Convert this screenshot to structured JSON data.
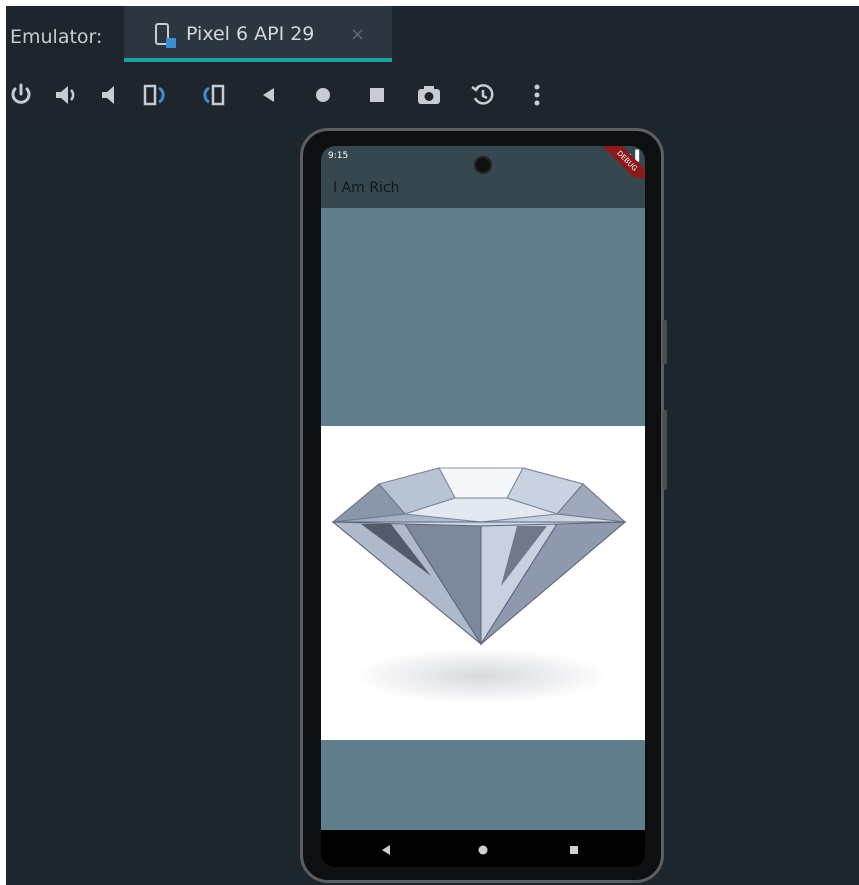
{
  "window": {
    "emulator_label": "Emulator:",
    "tab": {
      "title": "Pixel 6 API 29",
      "close_symbol": "×",
      "icon": "phone-device-icon"
    }
  },
  "toolbar": {
    "buttons": [
      {
        "name": "power-button",
        "icon": "power-icon"
      },
      {
        "name": "volume-up-button",
        "icon": "volume-up-icon"
      },
      {
        "name": "volume-down-button",
        "icon": "volume-down-icon"
      },
      {
        "name": "rotate-left-button",
        "icon": "rotate-left-icon"
      },
      {
        "name": "rotate-right-button",
        "icon": "rotate-right-icon"
      },
      {
        "name": "back-button",
        "icon": "back-triangle-icon"
      },
      {
        "name": "home-button",
        "icon": "home-circle-icon"
      },
      {
        "name": "overview-button",
        "icon": "overview-square-icon"
      },
      {
        "name": "screenshot-button",
        "icon": "camera-icon"
      },
      {
        "name": "snapshot-button",
        "icon": "snapshot-icon"
      },
      {
        "name": "more-button",
        "icon": "more-vertical-icon"
      }
    ]
  },
  "device": {
    "status_time": "9:15",
    "debug_banner": "DEBUG",
    "app_title": "I Am Rich",
    "image": "diamond-image",
    "nav_buttons": [
      "back-triangle-icon",
      "home-circle-icon",
      "overview-square-icon"
    ]
  },
  "colors": {
    "ide_background": "#1e252c",
    "tab_accent": "#1aa29e",
    "app_bar": "#37474f",
    "app_body": "#607d8b",
    "debug_ribbon": "#8b1a1a"
  }
}
